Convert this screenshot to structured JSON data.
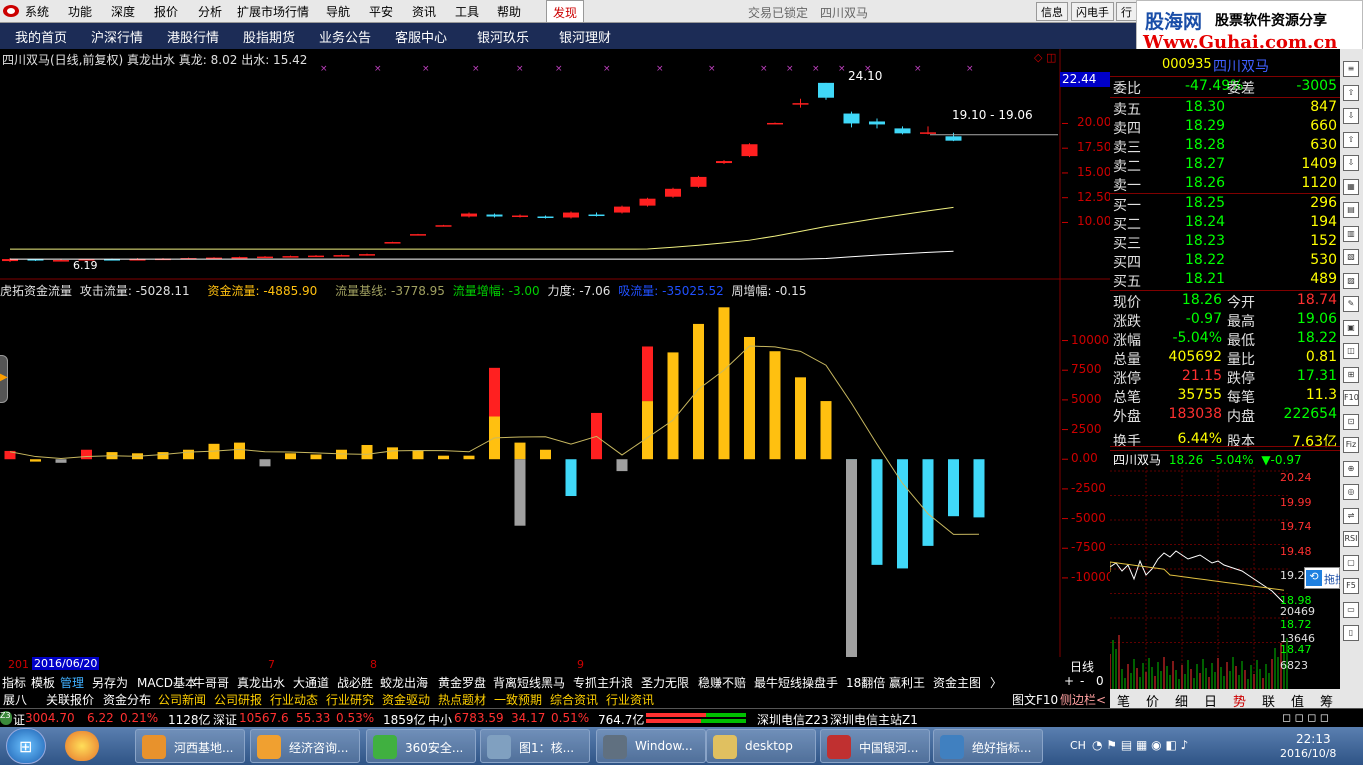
{
  "menu": {
    "items": [
      "系统",
      "功能",
      "深度",
      "报价",
      "分析",
      "扩展市场行情",
      "导航",
      "平安",
      "资讯",
      "工具",
      "帮助"
    ],
    "highlight": "发现",
    "center1": "交易已锁定",
    "center2": "四川双马",
    "buttons": [
      "信息",
      "闪电手",
      "行"
    ]
  },
  "nav": {
    "items": [
      "我的首页",
      "沪深行情",
      "港股行情",
      "股指期货",
      "业务公告",
      "客服中心",
      "银河玖乐",
      "银河理财"
    ]
  },
  "logo": {
    "t1": "股海网",
    "t2": "股票软件资源分享",
    "t3": "Www.Guhai.com.cn"
  },
  "stock_code": "000935",
  "stock_name": "四川双马",
  "kline": {
    "header": "四川双马(日线,前复权) 真龙出水 真龙: 8.02 出水: 15.42",
    "high_label": "24.10",
    "range_label": "19.10 - 19.06",
    "low_label": "6.19",
    "price_box": "22.44",
    "axis": [
      "20.00",
      "17.50",
      "15.00",
      "12.50",
      "10.00"
    ],
    "axis_values": [
      20,
      17.5,
      15,
      12.5,
      10
    ],
    "ylim": [
      5.5,
      25.5
    ],
    "candles": [
      {
        "o": 6.1,
        "c": 6.3,
        "h": 6.4,
        "l": 6.0
      },
      {
        "o": 6.3,
        "c": 6.2,
        "h": 6.3,
        "l": 6.1
      },
      {
        "o": 6.2,
        "c": 6.2,
        "h": 6.3,
        "l": 6.1
      },
      {
        "o": 6.2,
        "c": 6.3,
        "h": 6.3,
        "l": 6.19
      },
      {
        "o": 6.3,
        "c": 6.25,
        "h": 6.35,
        "l": 6.2
      },
      {
        "o": 6.25,
        "c": 6.3,
        "h": 6.4,
        "l": 6.2
      },
      {
        "o": 6.3,
        "c": 6.35,
        "h": 6.4,
        "l": 6.25
      },
      {
        "o": 6.35,
        "c": 6.4,
        "h": 6.45,
        "l": 6.3
      },
      {
        "o": 6.4,
        "c": 6.45,
        "h": 6.5,
        "l": 6.35
      },
      {
        "o": 6.45,
        "c": 6.5,
        "h": 6.55,
        "l": 6.4
      },
      {
        "o": 6.5,
        "c": 6.55,
        "h": 6.6,
        "l": 6.45
      },
      {
        "o": 6.55,
        "c": 6.6,
        "h": 6.65,
        "l": 6.5
      },
      {
        "o": 6.6,
        "c": 6.65,
        "h": 6.7,
        "l": 6.55
      },
      {
        "o": 6.65,
        "c": 6.7,
        "h": 6.75,
        "l": 6.6
      },
      {
        "o": 6.7,
        "c": 6.8,
        "h": 6.85,
        "l": 6.65
      },
      {
        "o": 8.0,
        "c": 8.02,
        "h": 8.05,
        "l": 7.98
      },
      {
        "o": 8.8,
        "c": 8.82,
        "h": 8.85,
        "l": 8.78
      },
      {
        "o": 9.7,
        "c": 9.72,
        "h": 9.75,
        "l": 9.68
      },
      {
        "o": 10.6,
        "c": 10.9,
        "h": 11.0,
        "l": 10.5
      },
      {
        "o": 10.8,
        "c": 10.6,
        "h": 10.9,
        "l": 10.5
      },
      {
        "o": 10.6,
        "c": 10.7,
        "h": 10.8,
        "l": 10.5
      },
      {
        "o": 10.6,
        "c": 10.5,
        "h": 10.7,
        "l": 10.4
      },
      {
        "o": 10.5,
        "c": 11.0,
        "h": 11.1,
        "l": 10.4
      },
      {
        "o": 10.8,
        "c": 10.7,
        "h": 11.0,
        "l": 10.6
      },
      {
        "o": 11.0,
        "c": 11.6,
        "h": 11.7,
        "l": 10.9
      },
      {
        "o": 11.7,
        "c": 12.4,
        "h": 12.5,
        "l": 11.6
      },
      {
        "o": 12.6,
        "c": 13.4,
        "h": 13.5,
        "l": 12.5
      },
      {
        "o": 13.6,
        "c": 14.6,
        "h": 14.7,
        "l": 13.5
      },
      {
        "o": 16.0,
        "c": 16.2,
        "h": 16.3,
        "l": 15.9
      },
      {
        "o": 16.7,
        "c": 17.9,
        "h": 18.0,
        "l": 16.6
      },
      {
        "o": 20.0,
        "c": 20.05,
        "h": 20.1,
        "l": 19.95
      },
      {
        "o": 22.0,
        "c": 22.05,
        "h": 22.5,
        "l": 21.6
      },
      {
        "o": 24.1,
        "c": 22.6,
        "h": 24.1,
        "l": 22.4
      },
      {
        "o": 21.0,
        "c": 20.0,
        "h": 21.2,
        "l": 19.6
      },
      {
        "o": 20.2,
        "c": 19.9,
        "h": 20.5,
        "l": 19.5
      },
      {
        "o": 19.5,
        "c": 19.0,
        "h": 19.7,
        "l": 18.9
      },
      {
        "o": 19.06,
        "c": 19.1,
        "h": 19.7,
        "l": 18.9
      },
      {
        "o": 18.7,
        "c": 18.26,
        "h": 19.06,
        "l": 18.22
      }
    ]
  },
  "indicator": {
    "name": "虎拓资金流量",
    "l1": "攻击流量: -5028.11",
    "l2": "资金流量: -4885.90",
    "l3": "流量基线: -3778.95",
    "l4": "流量增幅: -3.00",
    "l5": "力度: -7.06",
    "l6": "吸流量: -35025.52",
    "l7": "周增幅: -0.15",
    "axis": [
      "10000",
      "7500",
      "5000",
      "2500",
      "0.00",
      "-2500",
      "-5000",
      "-7500",
      "-10000"
    ],
    "axis_values": [
      10000,
      7500,
      5000,
      2500,
      0,
      -2500,
      -5000,
      -7500,
      -10000
    ],
    "ylim": [
      -17000,
      13500
    ],
    "bars": [
      {
        "v": 700,
        "c": "r"
      },
      {
        "v": -200,
        "c": "y"
      },
      {
        "v": -300,
        "c": "g"
      },
      {
        "v": 800,
        "c": "r"
      },
      {
        "v": 600,
        "c": "y"
      },
      {
        "v": 500,
        "c": "y"
      },
      {
        "v": 600,
        "c": "y"
      },
      {
        "v": 800,
        "c": "y"
      },
      {
        "v": 1300,
        "c": "y"
      },
      {
        "v": 1400,
        "c": "y"
      },
      {
        "v": -600,
        "c": "g"
      },
      {
        "v": 500,
        "c": "y"
      },
      {
        "v": 400,
        "c": "y"
      },
      {
        "v": 800,
        "c": "y"
      },
      {
        "v": 1200,
        "c": "y"
      },
      {
        "v": 1000,
        "c": "y"
      },
      {
        "v": 700,
        "c": "y"
      },
      {
        "v": 300,
        "c": "y"
      },
      {
        "v": 300,
        "c": "y"
      },
      {
        "v": 7700,
        "c": "r",
        "y2": 3600
      },
      {
        "v": 1400,
        "c": "y",
        "n": -5600
      },
      {
        "v": 800,
        "c": "y"
      },
      {
        "v": -3100,
        "c": "b"
      },
      {
        "v": 3900,
        "c": "r"
      },
      {
        "v": -1000,
        "c": "g"
      },
      {
        "v": 9500,
        "c": "r",
        "y2": 4900
      },
      {
        "v": 9000,
        "c": "y"
      },
      {
        "v": 11400,
        "c": "y"
      },
      {
        "v": 12800,
        "c": "y"
      },
      {
        "v": 10300,
        "c": "y"
      },
      {
        "v": 9100,
        "c": "y"
      },
      {
        "v": 6900,
        "c": "y"
      },
      {
        "v": 4900,
        "c": "y"
      },
      {
        "v": -5000,
        "c": "b",
        "n": -16800
      },
      {
        "v": -8900,
        "c": "b"
      },
      {
        "v": -9200,
        "c": "b"
      },
      {
        "v": -7300,
        "c": "b"
      },
      {
        "v": -4800,
        "c": "b"
      },
      {
        "v": -4900,
        "c": "b"
      }
    ]
  },
  "dates": {
    "d1": "201",
    "sel": "2016/06/20",
    "m7": "7",
    "m8": "8",
    "m9": "9",
    "period": "日线"
  },
  "quote": {
    "weibi": {
      "l": "委比",
      "v": "-47.49%",
      "l2": "委差",
      "v2": "-3005"
    },
    "asks": [
      {
        "l": "卖五",
        "p": "18.30",
        "v": "847"
      },
      {
        "l": "卖四",
        "p": "18.29",
        "v": "660"
      },
      {
        "l": "卖三",
        "p": "18.28",
        "v": "630"
      },
      {
        "l": "卖二",
        "p": "18.27",
        "v": "1409"
      },
      {
        "l": "卖一",
        "p": "18.26",
        "v": "1120"
      }
    ],
    "bids": [
      {
        "l": "买一",
        "p": "18.25",
        "v": "296"
      },
      {
        "l": "买二",
        "p": "18.24",
        "v": "194"
      },
      {
        "l": "买三",
        "p": "18.23",
        "v": "152"
      },
      {
        "l": "买四",
        "p": "18.22",
        "v": "530"
      },
      {
        "l": "买五",
        "p": "18.21",
        "v": "489"
      }
    ],
    "stats": [
      {
        "l": "现价",
        "v": "18.26",
        "l2": "今开",
        "v2": "18.74"
      },
      {
        "l": "涨跌",
        "v": "-0.97",
        "l2": "最高",
        "v2": "19.06"
      },
      {
        "l": "涨幅",
        "v": "-5.04%",
        "l2": "最低",
        "v2": "18.22"
      },
      {
        "l": "总量",
        "v": "405692",
        "l2": "量比",
        "v2": "0.81"
      },
      {
        "l": "涨停",
        "v": "21.15",
        "l2": "跌停",
        "v2": "17.31"
      },
      {
        "l": "总笔",
        "v": "35755",
        "l2": "每笔",
        "v2": "11.3"
      },
      {
        "l": "外盘",
        "v": "183038",
        "l2": "内盘",
        "v2": "222654"
      },
      {
        "l": "换手",
        "v": "6.44%",
        "l2": "股本",
        "v2": "7.63亿"
      }
    ],
    "mini_title": "四川双马",
    "mini_price": "18.26",
    "mini_pct": "-5.04%",
    "mini_chg": "▼-0.97",
    "mini_axis": [
      "20.24",
      "19.99",
      "19.74",
      "19.48",
      "19.23",
      "18.98",
      "18.72",
      "18.47",
      "20469",
      "13646",
      "6823"
    ],
    "float_btn": "拖拽"
  },
  "tabs1": [
    "指标",
    "模板",
    "管理",
    "另存为",
    "MACD基本",
    "牛哥哥",
    "真龙出水",
    "大通道",
    "战必胜",
    "蛟龙出海",
    "黄金罗盘",
    "背离短线黑马",
    "专抓主升浪",
    "圣力无限",
    "稳赚不赔",
    "最牛短线操盘手",
    "18翻倍",
    "赢利王",
    "资金主图",
    "〉"
  ],
  "tabs1_right": [
    "+",
    "-",
    "0"
  ],
  "tabs2": [
    "展八",
    "关联报价",
    "资金分布",
    "公司新闻",
    "公司研报",
    "行业动态",
    "行业研究",
    "资金驱动",
    "热点题材",
    "一致预期",
    "综合资讯",
    "行业资讯"
  ],
  "tabs2_right": [
    "图文F10",
    "侧边栏<"
  ],
  "rtabs": [
    "笔",
    "价",
    "细",
    "日",
    "势",
    "联",
    "值",
    "筹"
  ],
  "status": {
    "sh": {
      "name": "证",
      "val": "3004.70",
      "chg": "6.22",
      "pct": "0.21%",
      "amt": "1128亿"
    },
    "sz": {
      "name": "深证",
      "val": "10567.6",
      "chg": "55.33",
      "pct": "0.53%",
      "amt": "1859亿"
    },
    "zx": {
      "name": "中小",
      "val": "6783.59",
      "chg": "34.17",
      "pct": "0.51%",
      "amt": "764.7亿"
    },
    "conn1": "深圳电信Z23",
    "conn2": "深圳电信主站Z1"
  },
  "taskbar": {
    "items": [
      "河西基地...",
      "经济咨询...",
      "360安全...",
      "图1：核...",
      "Window...",
      "desktop",
      "中国银河...",
      "绝好指标..."
    ],
    "lang": "CH",
    "time": "22:13",
    "date": "2016/10/8"
  },
  "colors": {
    "up": "#ff2020",
    "down": "#40d8f8",
    "yellow": "#ffc010",
    "grey": "#a0a0a0",
    "ma1": "#f0f080",
    "ma2": "#ffffff",
    "frame": "#800000"
  }
}
